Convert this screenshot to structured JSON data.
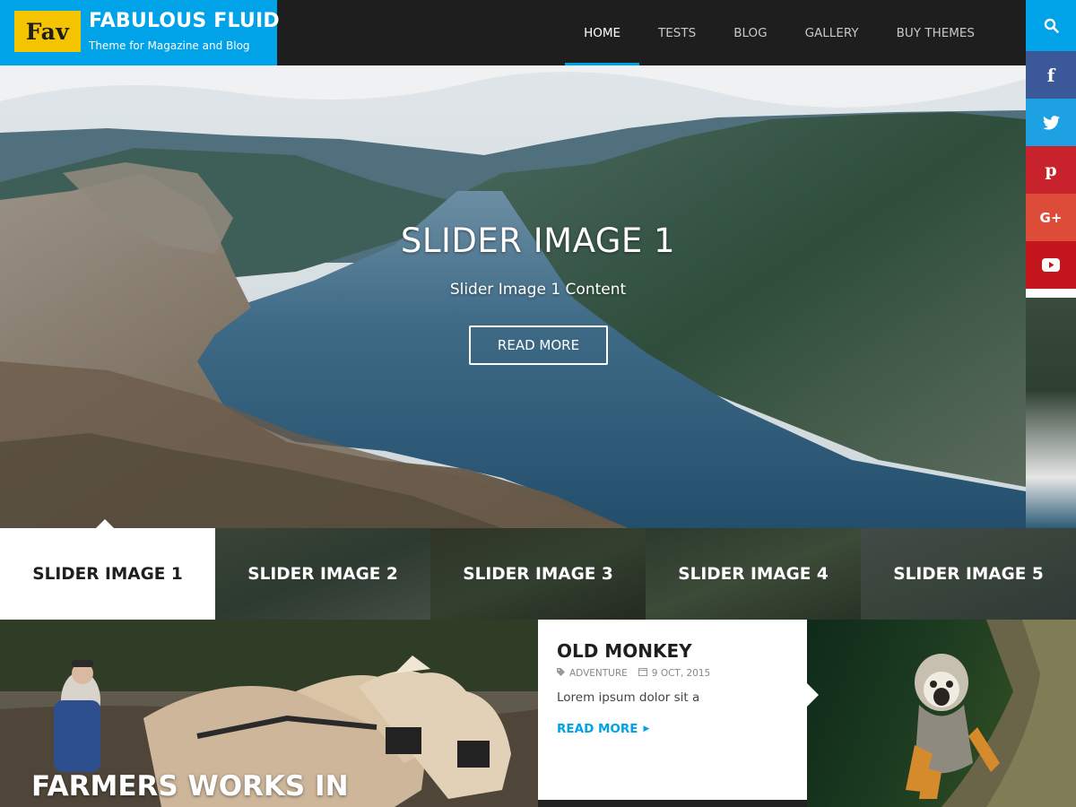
{
  "brand": {
    "logo_text": "Fav",
    "site_title": "FABULOUS FLUID",
    "tagline": "Theme for Magazine and Blog"
  },
  "nav": {
    "items": [
      {
        "label": "HOME",
        "active": true
      },
      {
        "label": "TESTS",
        "active": false
      },
      {
        "label": "BLOG",
        "active": false
      },
      {
        "label": "GALLERY",
        "active": false
      },
      {
        "label": "BUY THEMES",
        "active": false
      }
    ]
  },
  "social": {
    "items": [
      {
        "icon": "search-icon",
        "glyph": "",
        "color": "#00a3e8"
      },
      {
        "icon": "facebook-icon",
        "glyph": "f",
        "color": "#3b5998"
      },
      {
        "icon": "twitter-icon",
        "glyph": "",
        "color": "#1da1e2"
      },
      {
        "icon": "pinterest-icon",
        "glyph": "p",
        "color": "#c8232c"
      },
      {
        "icon": "google-plus-icon",
        "glyph": "G+",
        "color": "#dd4b39"
      },
      {
        "icon": "youtube-icon",
        "glyph": "",
        "color": "#c4161c"
      }
    ]
  },
  "hero": {
    "title": "SLIDER IMAGE 1",
    "content": "Slider Image 1 Content",
    "button_label": "READ MORE"
  },
  "tabs": {
    "items": [
      {
        "label": "SLIDER IMAGE 1",
        "active": true
      },
      {
        "label": "SLIDER IMAGE 2",
        "active": false
      },
      {
        "label": "SLIDER IMAGE 3",
        "active": false
      },
      {
        "label": "SLIDER IMAGE 4",
        "active": false
      },
      {
        "label": "SLIDER IMAGE 5",
        "active": false
      }
    ]
  },
  "feature": {
    "caption": "FARMERS WORKS IN"
  },
  "post": {
    "title": "OLD MONKEY",
    "category": "ADVENTURE",
    "date": "9 OCT, 2015",
    "excerpt": "Lorem ipsum dolor sit a",
    "read_more": "READ MORE"
  },
  "colors": {
    "accent": "#00a3e8",
    "logo_bg": "#f5c400",
    "header_bg": "#1e1e1e"
  }
}
